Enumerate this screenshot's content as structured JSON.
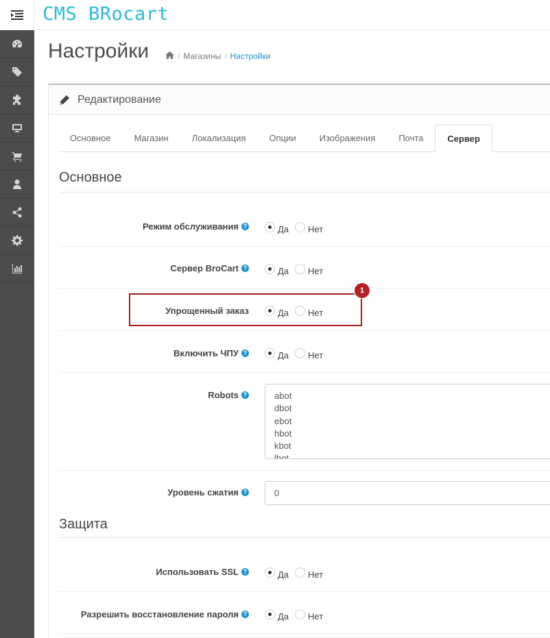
{
  "header": {
    "logo": "CMS BRocart"
  },
  "page": {
    "title": "Настройки"
  },
  "breadcrumb": {
    "home": "",
    "item1": "Магазины",
    "item2": "Настройки"
  },
  "panel": {
    "heading": "Редактирование"
  },
  "tabs": [
    {
      "label": "Основное"
    },
    {
      "label": "Магазин"
    },
    {
      "label": "Локализация"
    },
    {
      "label": "Опции"
    },
    {
      "label": "Изображения"
    },
    {
      "label": "Почта"
    },
    {
      "label": "Сервер"
    }
  ],
  "active_tab": "Сервер",
  "section_main": "Основное",
  "section_security": "Защита",
  "radio_yes": "Да",
  "radio_no": "Нет",
  "help_glyph": "?",
  "fields": {
    "maintenance": {
      "label": "Режим обслуживания",
      "value": "Да"
    },
    "server": {
      "label": "Сервер BroCart",
      "value": "Да"
    },
    "simple_order": {
      "label": "Упрощенный заказ",
      "value": "Да"
    },
    "seo_url": {
      "label": "Включить ЧПУ",
      "value": "Да"
    },
    "robots": {
      "label": "Robots",
      "lines": [
        "abot",
        "dbot",
        "ebot",
        "hbot",
        "kbot",
        "lbot"
      ]
    },
    "compression": {
      "label": "Уровень сжатия",
      "value": "0"
    },
    "use_ssl": {
      "label": "Использовать SSL",
      "value": "Да"
    },
    "password_reset": {
      "label": "Разрешить восстановление пароля",
      "value": "Да"
    }
  },
  "annotation": {
    "number": "1",
    "color": "#b32222"
  },
  "colors": {
    "accent": "#1e91cf",
    "logo": "#2bbdd6",
    "sidebar": "#4c4c4c"
  },
  "sidebar_icons": [
    "dashboard-icon",
    "tag-icon",
    "puzzle-icon",
    "desktop-icon",
    "cart-icon",
    "user-icon",
    "share-icon",
    "gear-icon",
    "bar-chart-icon"
  ]
}
